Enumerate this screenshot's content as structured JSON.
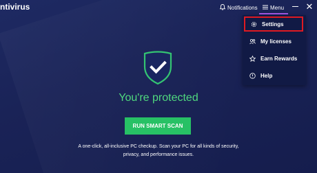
{
  "titlebar": {
    "app_title": "ntivirus",
    "notifications_label": "Notifications",
    "menu_label": "Menu"
  },
  "icons": {
    "notifications": "bell-icon",
    "menu": "hamburger-icon",
    "minimize": "minimize-icon",
    "close": "close-icon",
    "protected": "shield-check-icon"
  },
  "dropdown": {
    "items": [
      {
        "label": "Settings",
        "icon": "gear-icon",
        "selected": true
      },
      {
        "label": "My licenses",
        "icon": "licenses-icon",
        "selected": false
      },
      {
        "label": "Earn Rewards",
        "icon": "star-icon",
        "selected": false
      },
      {
        "label": "Help",
        "icon": "help-icon",
        "selected": false
      }
    ]
  },
  "main": {
    "status": "You're protected",
    "scan_button": "RUN SMART SCAN",
    "description_line1": "A one-click, all-inclusive PC checkup. Scan your PC for all kinds of security,",
    "description_line2": "privacy, and performance issues."
  },
  "colors": {
    "background": "#1b2358",
    "accent_green": "#27c165",
    "status_green": "#4fd97e",
    "menu_underline": "#a259e6",
    "highlight_red": "#e01a22"
  }
}
